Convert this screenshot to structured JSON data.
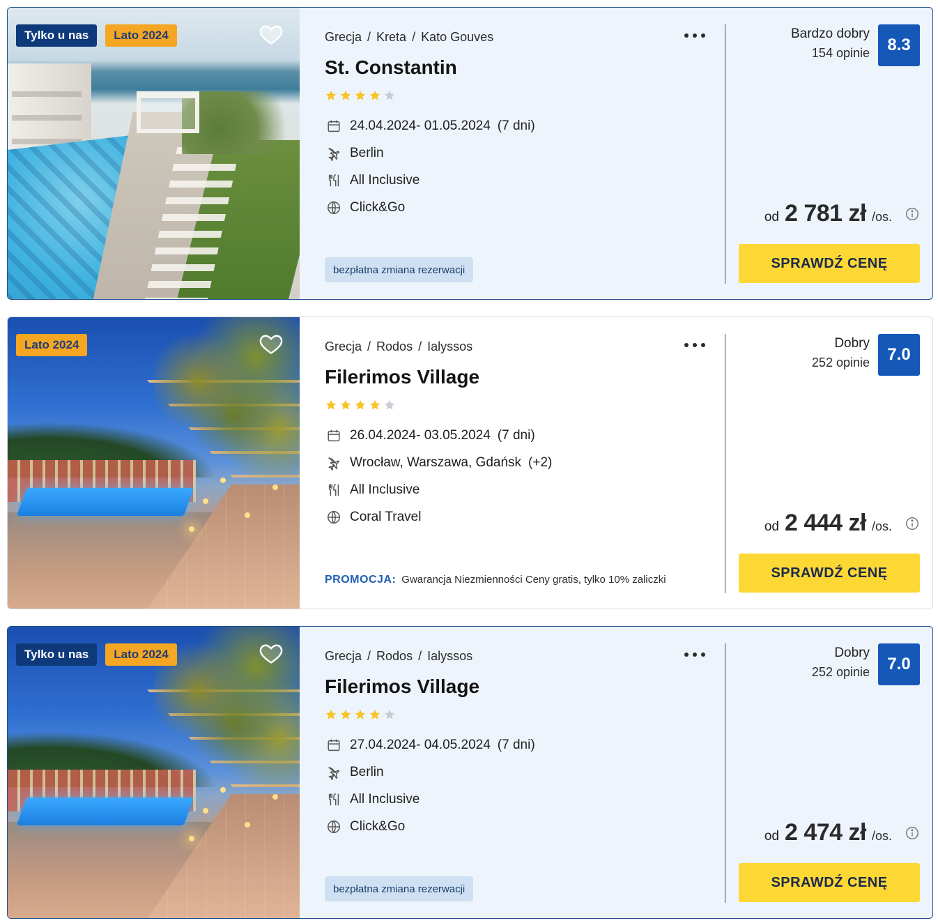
{
  "listings": [
    {
      "badges": {
        "exclusive": "Tylko u nas",
        "season": "Lato 2024"
      },
      "location": {
        "country": "Grecja",
        "region": "Kreta",
        "city": "Kato Gouves"
      },
      "sep": "/",
      "name": "St. Constantin",
      "stars_filled": 4,
      "stars_total": 5,
      "dates": "24.04.2024- 01.05.2024",
      "duration": "(7 dni)",
      "departure": "Berlin",
      "departure_extra": "",
      "board": "All Inclusive",
      "operator": "Click&Go",
      "tag": "bezpłatna zmiana rezerwacji",
      "rating_label": "Bardzo dobry",
      "rating_count": "154 opinie",
      "rating_score": "8.3",
      "price_from": "od",
      "price": "2 781 zł",
      "price_unit": "/os.",
      "cta": "SPRAWDŹ CENĘ"
    },
    {
      "badges": {
        "season": "Lato 2024"
      },
      "location": {
        "country": "Grecja",
        "region": "Rodos",
        "city": "Ialyssos"
      },
      "sep": "/",
      "name": "Filerimos Village",
      "stars_filled": 4,
      "stars_total": 5,
      "dates": "26.04.2024- 03.05.2024",
      "duration": "(7 dni)",
      "departure": "Wrocław, Warszawa, Gdańsk",
      "departure_extra": "(+2)",
      "board": "All Inclusive",
      "operator": "Coral Travel",
      "promo_label": "PROMOCJA:",
      "promo_text": "Gwarancja Niezmienności Ceny gratis, tylko 10% zaliczki",
      "rating_label": "Dobry",
      "rating_count": "252 opinie",
      "rating_score": "7.0",
      "price_from": "od",
      "price": "2 444 zł",
      "price_unit": "/os.",
      "cta": "SPRAWDŹ CENĘ"
    },
    {
      "badges": {
        "exclusive": "Tylko u nas",
        "season": "Lato 2024"
      },
      "location": {
        "country": "Grecja",
        "region": "Rodos",
        "city": "Ialyssos"
      },
      "sep": "/",
      "name": "Filerimos Village",
      "stars_filled": 4,
      "stars_total": 5,
      "dates": "27.04.2024- 04.05.2024",
      "duration": "(7 dni)",
      "departure": "Berlin",
      "departure_extra": "",
      "board": "All Inclusive",
      "operator": "Click&Go",
      "tag": "bezpłatna zmiana rezerwacji",
      "rating_label": "Dobry",
      "rating_count": "252 opinie",
      "rating_score": "7.0",
      "price_from": "od",
      "price": "2 474 zł",
      "price_unit": "/os.",
      "cta": "SPRAWDŹ CENĘ"
    }
  ],
  "icons": {
    "favorite": "heart-icon",
    "menu": "more-options-icon",
    "calendar": "calendar-icon",
    "flight": "plane-icon",
    "board": "cutlery-icon",
    "operator": "globe-icon",
    "info": "info-icon",
    "star": "star-icon"
  },
  "colors": {
    "badge_exclusive": "#0e3a7b",
    "badge_season": "#f5a623",
    "rating_score": "#1558b8",
    "cta": "#fdd835",
    "star_filled": "#f7c325",
    "star_empty": "#c9cdd3",
    "promo_label": "#1f5fb5",
    "highlight_bg": "#eef4fb"
  }
}
